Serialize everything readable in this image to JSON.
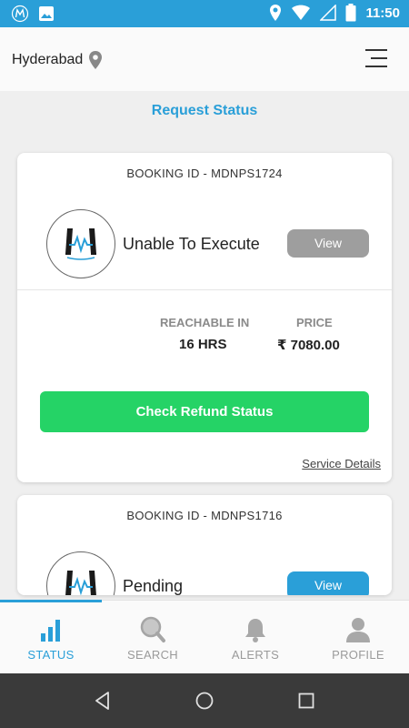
{
  "status_bar": {
    "time": "11:50",
    "left_icons": [
      "app-logo-icon",
      "image-icon"
    ],
    "right_icons": [
      "location-icon",
      "wifi-icon",
      "signal-icon",
      "battery-icon"
    ]
  },
  "header": {
    "city": "Hyderabad",
    "city_icon": "location-pin-icon",
    "menu_icon": "menu-icon"
  },
  "page_title": "Request Status",
  "bookings": [
    {
      "booking_id": "BOOKING ID - MDNPS1724",
      "status": "Unable To Execute",
      "view_label": "View",
      "reachable_label": "REACHABLE IN",
      "reachable_value": "16 HRS",
      "price_label": "PRICE",
      "price_value": "₹ 7080.00",
      "action_label": "Check Refund Status",
      "service_link": "Service Details"
    },
    {
      "booking_id": "BOOKING ID - MDNPS1716",
      "status": "Pending",
      "view_label": "View"
    }
  ],
  "bottom_nav": [
    {
      "label": "STATUS",
      "icon": "bar-chart-icon",
      "active": true
    },
    {
      "label": "SEARCH",
      "icon": "search-icon",
      "active": false
    },
    {
      "label": "ALERTS",
      "icon": "bell-icon",
      "active": false
    },
    {
      "label": "PROFILE",
      "icon": "user-icon",
      "active": false
    }
  ],
  "colors": {
    "accent": "#2a9fd8",
    "success": "#25d366",
    "muted_button": "#9e9e9e"
  }
}
